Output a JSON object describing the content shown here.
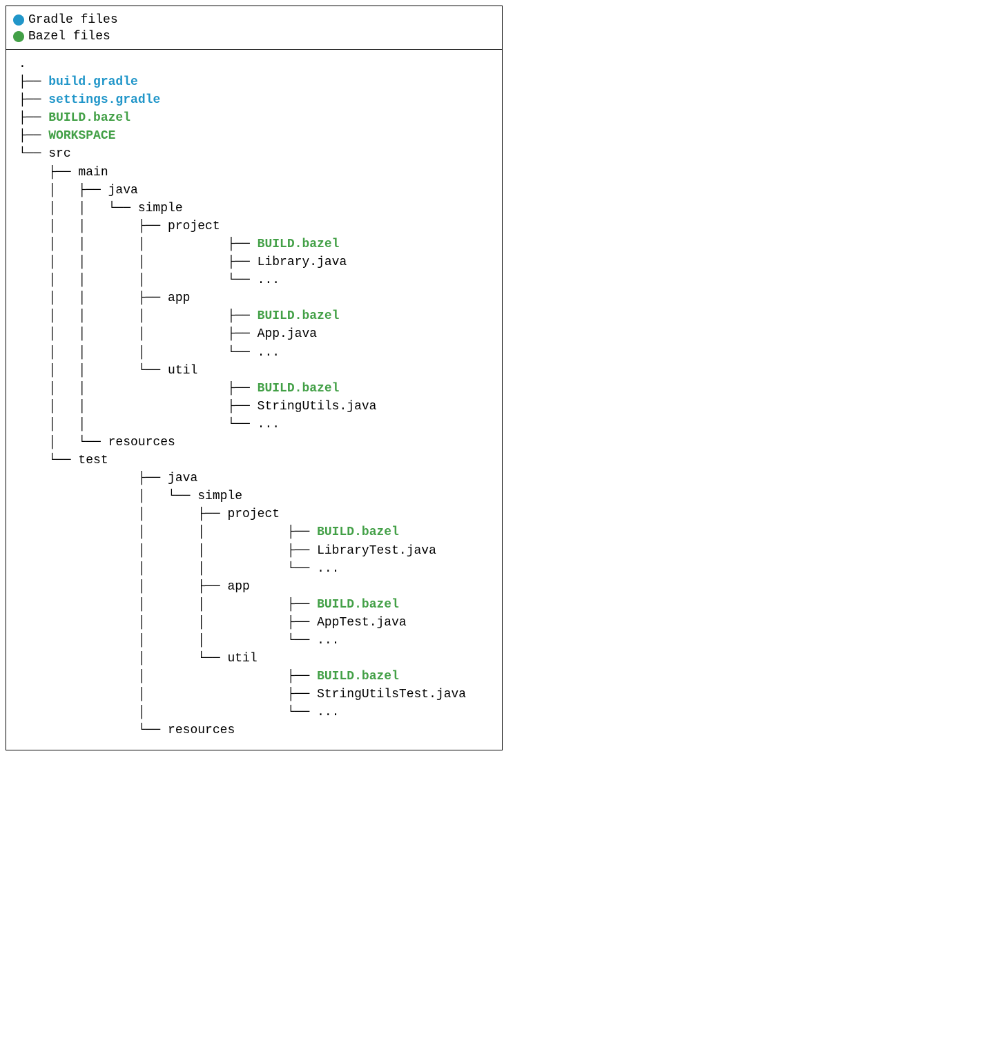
{
  "legend": {
    "gradle": "Gradle files",
    "bazel": "Bazel files",
    "colors": {
      "gradle": "#2196c9",
      "bazel": "#43a047"
    }
  },
  "tree": [
    {
      "prefix": ".",
      "label": "",
      "kind": "plain"
    },
    {
      "prefix": "├── ",
      "label": "build.gradle",
      "kind": "gradle"
    },
    {
      "prefix": "├── ",
      "label": "settings.gradle",
      "kind": "gradle"
    },
    {
      "prefix": "├── ",
      "label": "BUILD.bazel",
      "kind": "bazel"
    },
    {
      "prefix": "├── ",
      "label": "WORKSPACE",
      "kind": "bazel"
    },
    {
      "prefix": "└── ",
      "label": "src",
      "kind": "plain"
    },
    {
      "prefix": "    ├── ",
      "label": "main",
      "kind": "plain"
    },
    {
      "prefix": "    │   ├── ",
      "label": "java",
      "kind": "plain"
    },
    {
      "prefix": "    │   │   └── ",
      "label": "simple",
      "kind": "plain"
    },
    {
      "prefix": "    │   │       ├── ",
      "label": "project",
      "kind": "plain"
    },
    {
      "prefix": "    │   │       │           ├── ",
      "label": "BUILD.bazel",
      "kind": "bazel"
    },
    {
      "prefix": "    │   │       │           ├── ",
      "label": "Library.java",
      "kind": "plain"
    },
    {
      "prefix": "    │   │       │           └── ",
      "label": "...",
      "kind": "plain"
    },
    {
      "prefix": "    │   │       ├── ",
      "label": "app",
      "kind": "plain"
    },
    {
      "prefix": "    │   │       │           ├── ",
      "label": "BUILD.bazel",
      "kind": "bazel"
    },
    {
      "prefix": "    │   │       │           ├── ",
      "label": "App.java",
      "kind": "plain"
    },
    {
      "prefix": "    │   │       │           └── ",
      "label": "...",
      "kind": "plain"
    },
    {
      "prefix": "    │   │       └── ",
      "label": "util",
      "kind": "plain"
    },
    {
      "prefix": "    │   │                   ├── ",
      "label": "BUILD.bazel",
      "kind": "bazel"
    },
    {
      "prefix": "    │   │                   ├── ",
      "label": "StringUtils.java",
      "kind": "plain"
    },
    {
      "prefix": "    │   │                   └── ",
      "label": "...",
      "kind": "plain"
    },
    {
      "prefix": "    │   └── ",
      "label": "resources",
      "kind": "plain"
    },
    {
      "prefix": "    └── ",
      "label": "test",
      "kind": "plain"
    },
    {
      "prefix": "                ├── ",
      "label": "java",
      "kind": "plain"
    },
    {
      "prefix": "                │   └── ",
      "label": "simple",
      "kind": "plain"
    },
    {
      "prefix": "                │       ├── ",
      "label": "project",
      "kind": "plain"
    },
    {
      "prefix": "                │       │           ├── ",
      "label": "BUILD.bazel",
      "kind": "bazel"
    },
    {
      "prefix": "                │       │           ├── ",
      "label": "LibraryTest.java",
      "kind": "plain"
    },
    {
      "prefix": "                │       │           └── ",
      "label": "...",
      "kind": "plain"
    },
    {
      "prefix": "                │       ├── ",
      "label": "app",
      "kind": "plain"
    },
    {
      "prefix": "                │       │           ├── ",
      "label": "BUILD.bazel",
      "kind": "bazel"
    },
    {
      "prefix": "                │       │           ├── ",
      "label": "AppTest.java",
      "kind": "plain"
    },
    {
      "prefix": "                │       │           └── ",
      "label": "...",
      "kind": "plain"
    },
    {
      "prefix": "                │       └── ",
      "label": "util",
      "kind": "plain"
    },
    {
      "prefix": "                │                   ├── ",
      "label": "BUILD.bazel",
      "kind": "bazel"
    },
    {
      "prefix": "                │                   ├── ",
      "label": "StringUtilsTest.java",
      "kind": "plain"
    },
    {
      "prefix": "                │                   └── ",
      "label": "...",
      "kind": "plain"
    },
    {
      "prefix": "                └── ",
      "label": "resources",
      "kind": "plain"
    }
  ]
}
